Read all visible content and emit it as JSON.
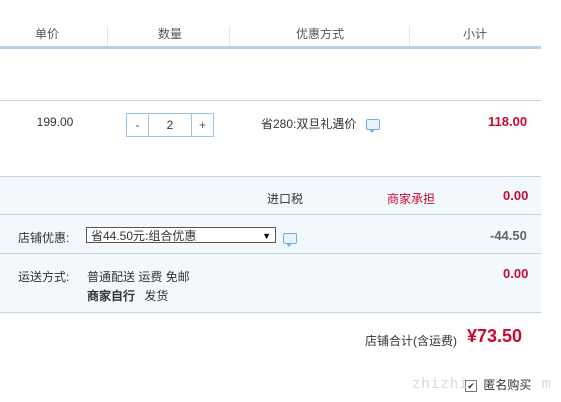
{
  "header": {
    "unit_price": "单价",
    "quantity": "数量",
    "promotion": "优惠方式",
    "subtotal": "小计"
  },
  "item": {
    "unit_price": "199.00",
    "qty_minus": "-",
    "qty_value": "2",
    "qty_plus": "+",
    "promotion": "省280:双旦礼遇价",
    "subtotal": "118.00"
  },
  "import_tax": {
    "label": "进口税",
    "bearer": "商家承担",
    "amount": "0.00"
  },
  "shop_discount": {
    "label": "店铺优惠:",
    "selected": "省44.50元:组合优惠",
    "amount": "-44.50"
  },
  "shipping": {
    "label": "运送方式:",
    "method": "普通配送 运费 免邮",
    "seller": "商家自行",
    "dispatch": "发货",
    "amount": "0.00"
  },
  "total": {
    "label": "店铺合计(含运费)",
    "amount": "¥73.50"
  },
  "anonymous": {
    "label": "匿名购买",
    "checked": true
  },
  "watermark": {
    "text": "zhizhi",
    "suffix": "m"
  },
  "colors": {
    "accent_red": "#c80a32",
    "border_blue": "#bcd5ea",
    "row_tint": "#f3f8fd"
  }
}
